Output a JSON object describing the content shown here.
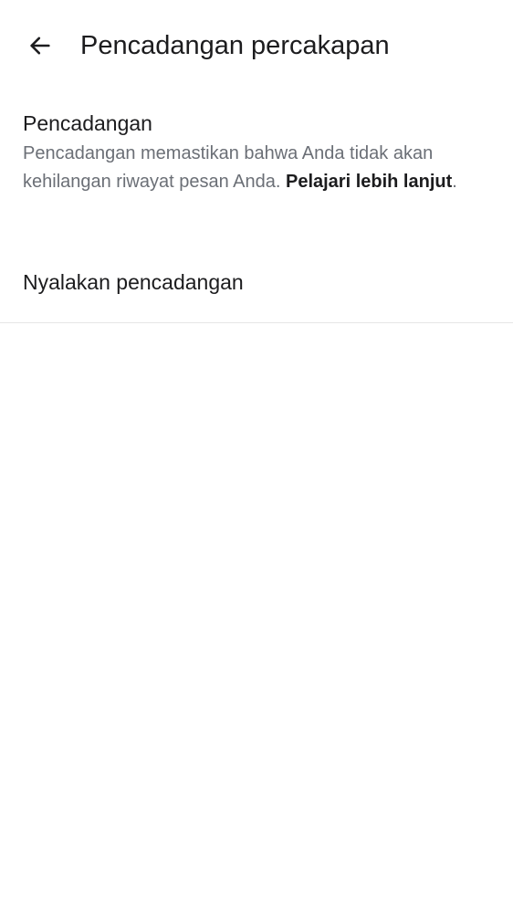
{
  "header": {
    "back_icon": "arrow-left-icon",
    "title": "Pencadangan percakapan"
  },
  "backup_section": {
    "title": "Pencadangan",
    "description": "Pencadangan memastikan bahwa Anda tidak akan kehilangan riwayat pesan Anda. ",
    "learn_more": "Pelajari lebih lanjut",
    "description_end": "."
  },
  "settings": {
    "turn_on_backup": "Nyalakan pencadangan"
  }
}
